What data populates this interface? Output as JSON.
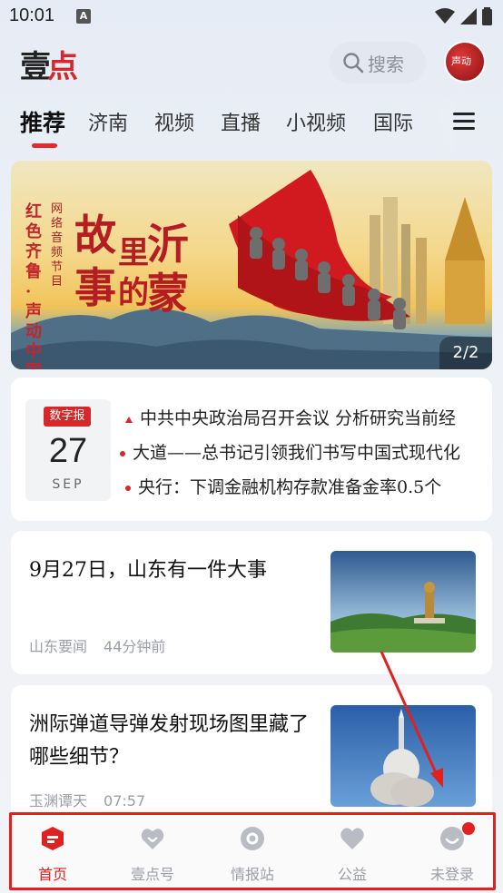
{
  "status_bar": {
    "time": "10:01",
    "indicator": "A"
  },
  "header": {
    "logo_text": "壹",
    "logo_dot": "点",
    "search_placeholder": "搜索"
  },
  "tabs": [
    {
      "label": "推荐",
      "active": true
    },
    {
      "label": "济南"
    },
    {
      "label": "视频"
    },
    {
      "label": "直播"
    },
    {
      "label": "小视频"
    },
    {
      "label": "国际"
    }
  ],
  "banner": {
    "side_text": "红色齐鲁·声动中国",
    "sub_text": "网络音频节目",
    "title_a": "故",
    "title_b": "事",
    "title_c": "里",
    "title_d": "的",
    "title_e": "沂",
    "title_f": "蒙",
    "page_indicator": "2/2"
  },
  "digital_news": {
    "tag": "数字报",
    "day": "27",
    "month": "SEP",
    "headlines": [
      "中共中央政治局召开会议 分析研究当前经",
      "大道——总书记引领我们书写中国式现代化",
      "央行：下调金融机构存款准备金率0.5个"
    ]
  },
  "articles": [
    {
      "title": "9月27日，山东有一件大事",
      "source": "山东要闻",
      "time": "44分钟前"
    },
    {
      "title": "洲际弹道导弹发射现场图里藏了哪些细节？",
      "source": "玉渊谭天",
      "time": "07:57"
    }
  ],
  "bottom_nav": [
    {
      "label": "首页",
      "active": true
    },
    {
      "label": "壹点号"
    },
    {
      "label": "情报站"
    },
    {
      "label": "公益"
    },
    {
      "label": "未登录"
    }
  ],
  "colors": {
    "accent": "#e0211f",
    "brand_red": "#d6282c"
  }
}
